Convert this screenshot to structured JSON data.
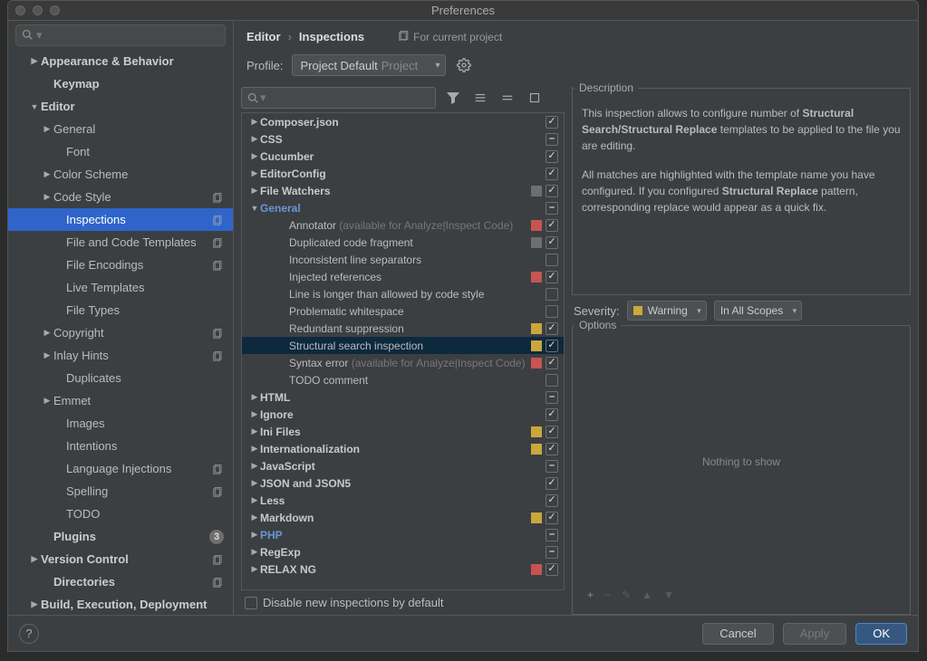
{
  "window_title": "Preferences",
  "sidebar": {
    "search_placeholder": "",
    "items": [
      {
        "label": "Appearance & Behavior",
        "arrow": "▶",
        "bold": true,
        "indent": 22
      },
      {
        "label": "Keymap",
        "arrow": "",
        "bold": true,
        "indent": 36
      },
      {
        "label": "Editor",
        "arrow": "▼",
        "bold": true,
        "indent": 22
      },
      {
        "label": "General",
        "arrow": "▶",
        "bold": false,
        "indent": 36
      },
      {
        "label": "Font",
        "arrow": "",
        "bold": false,
        "indent": 50
      },
      {
        "label": "Color Scheme",
        "arrow": "▶",
        "bold": false,
        "indent": 36
      },
      {
        "label": "Code Style",
        "arrow": "▶",
        "bold": false,
        "indent": 36,
        "proj": true
      },
      {
        "label": "Inspections",
        "arrow": "",
        "bold": false,
        "indent": 50,
        "sel": true,
        "proj": true
      },
      {
        "label": "File and Code Templates",
        "arrow": "",
        "bold": false,
        "indent": 50,
        "proj": true
      },
      {
        "label": "File Encodings",
        "arrow": "",
        "bold": false,
        "indent": 50,
        "proj": true
      },
      {
        "label": "Live Templates",
        "arrow": "",
        "bold": false,
        "indent": 50
      },
      {
        "label": "File Types",
        "arrow": "",
        "bold": false,
        "indent": 50
      },
      {
        "label": "Copyright",
        "arrow": "▶",
        "bold": false,
        "indent": 36,
        "proj": true
      },
      {
        "label": "Inlay Hints",
        "arrow": "▶",
        "bold": false,
        "indent": 36,
        "proj": true
      },
      {
        "label": "Duplicates",
        "arrow": "",
        "bold": false,
        "indent": 50
      },
      {
        "label": "Emmet",
        "arrow": "▶",
        "bold": false,
        "indent": 36
      },
      {
        "label": "Images",
        "arrow": "",
        "bold": false,
        "indent": 50
      },
      {
        "label": "Intentions",
        "arrow": "",
        "bold": false,
        "indent": 50
      },
      {
        "label": "Language Injections",
        "arrow": "",
        "bold": false,
        "indent": 50,
        "proj": true
      },
      {
        "label": "Spelling",
        "arrow": "",
        "bold": false,
        "indent": 50,
        "proj": true
      },
      {
        "label": "TODO",
        "arrow": "",
        "bold": false,
        "indent": 50
      },
      {
        "label": "Plugins",
        "arrow": "",
        "bold": true,
        "indent": 36,
        "badge": "3"
      },
      {
        "label": "Version Control",
        "arrow": "▶",
        "bold": true,
        "indent": 22,
        "proj": true
      },
      {
        "label": "Directories",
        "arrow": "",
        "bold": true,
        "indent": 36,
        "proj": true
      },
      {
        "label": "Build, Execution, Deployment",
        "arrow": "▶",
        "bold": true,
        "indent": 22
      }
    ]
  },
  "breadcrumb": {
    "a": "Editor",
    "b": "Inspections",
    "for": "For current project"
  },
  "profile": {
    "label": "Profile:",
    "value": "Project Default",
    "kind": "Project"
  },
  "inspections": [
    {
      "label": "Composer.json",
      "arrow": "▶",
      "indent": 8,
      "bold": true,
      "chk": "on"
    },
    {
      "label": "CSS",
      "arrow": "▶",
      "indent": 8,
      "bold": true,
      "chk": "mix"
    },
    {
      "label": "Cucumber",
      "arrow": "▶",
      "indent": 8,
      "bold": true,
      "chk": "on"
    },
    {
      "label": "EditorConfig",
      "arrow": "▶",
      "indent": 8,
      "bold": true,
      "chk": "on"
    },
    {
      "label": "File Watchers",
      "arrow": "▶",
      "indent": 8,
      "bold": true,
      "sev": "gry",
      "chk": "on"
    },
    {
      "label": "General",
      "arrow": "▼",
      "indent": 8,
      "blue": true,
      "chk": "mix"
    },
    {
      "label": "Annotator",
      "hint": " (available for Analyze|Inspect Code)",
      "indent": 40,
      "sev": "red",
      "chk": "on"
    },
    {
      "label": "Duplicated code fragment",
      "indent": 40,
      "sev": "gry",
      "chk": "on"
    },
    {
      "label": "Inconsistent line separators",
      "indent": 40,
      "chk": "off"
    },
    {
      "label": "Injected references",
      "indent": 40,
      "sev": "red",
      "chk": "on"
    },
    {
      "label": "Line is longer than allowed by code style",
      "indent": 40,
      "chk": "off"
    },
    {
      "label": "Problematic whitespace",
      "indent": 40,
      "chk": "off"
    },
    {
      "label": "Redundant suppression",
      "indent": 40,
      "sev": "yel",
      "chk": "on"
    },
    {
      "label": "Structural search inspection",
      "indent": 40,
      "sev": "yel",
      "chk": "on",
      "sel": true
    },
    {
      "label": "Syntax error",
      "hint": " (available for Analyze|Inspect Code)",
      "indent": 40,
      "sev": "red",
      "chk": "on"
    },
    {
      "label": "TODO comment",
      "indent": 40,
      "chk": "off"
    },
    {
      "label": "HTML",
      "arrow": "▶",
      "indent": 8,
      "bold": true,
      "chk": "mix"
    },
    {
      "label": "Ignore",
      "arrow": "▶",
      "indent": 8,
      "bold": true,
      "chk": "on"
    },
    {
      "label": "Ini Files",
      "arrow": "▶",
      "indent": 8,
      "bold": true,
      "sev": "yel",
      "chk": "on"
    },
    {
      "label": "Internationalization",
      "arrow": "▶",
      "indent": 8,
      "bold": true,
      "sev": "yel",
      "chk": "on"
    },
    {
      "label": "JavaScript",
      "arrow": "▶",
      "indent": 8,
      "bold": true,
      "chk": "mix"
    },
    {
      "label": "JSON and JSON5",
      "arrow": "▶",
      "indent": 8,
      "bold": true,
      "chk": "on"
    },
    {
      "label": "Less",
      "arrow": "▶",
      "indent": 8,
      "bold": true,
      "chk": "on"
    },
    {
      "label": "Markdown",
      "arrow": "▶",
      "indent": 8,
      "bold": true,
      "sev": "yel",
      "chk": "on"
    },
    {
      "label": "PHP",
      "arrow": "▶",
      "indent": 8,
      "blue": true,
      "chk": "mix"
    },
    {
      "label": "RegExp",
      "arrow": "▶",
      "indent": 8,
      "bold": true,
      "chk": "mix"
    },
    {
      "label": "RELAX NG",
      "arrow": "▶",
      "indent": 8,
      "bold": true,
      "sev": "red",
      "chk": "on"
    }
  ],
  "disable_label": "Disable new inspections by default",
  "description": {
    "title": "Description",
    "p1a": "This inspection allows to configure number of ",
    "p1b": "Structural Search/Structural Replace",
    "p1c": " templates to be applied to the file you are editing.",
    "p2a": "All matches are highlighted with the template name you have configured. If you configured ",
    "p2b": "Structural Replace",
    "p2c": " pattern, corresponding replace would appear as a quick fix."
  },
  "severity": {
    "label": "Severity:",
    "value": "Warning",
    "scope": "In All Scopes",
    "color": "#c9a83c"
  },
  "options": {
    "title": "Options",
    "empty": "Nothing to show"
  },
  "footer": {
    "cancel": "Cancel",
    "apply": "Apply",
    "ok": "OK"
  }
}
